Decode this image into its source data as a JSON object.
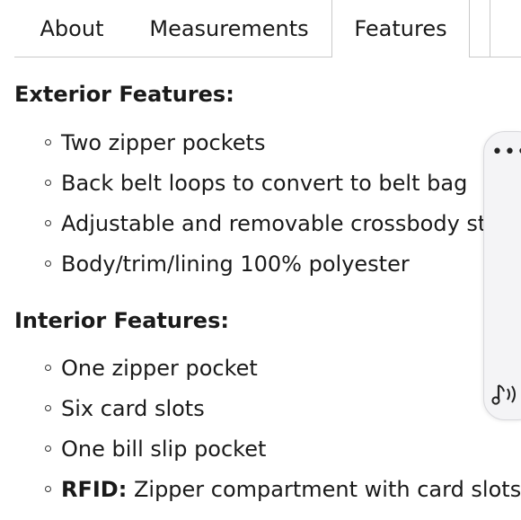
{
  "tabs": [
    {
      "label": "About"
    },
    {
      "label": "Measurements"
    },
    {
      "label": "Features",
      "active": true
    },
    {
      "label": ""
    }
  ],
  "exterior": {
    "title": "Exterior Features:",
    "items": [
      "Two zipper pockets",
      "Back belt loops to convert to belt bag",
      "Adjustable and removable crossbody strap",
      "Body/trim/lining 100% polyester"
    ]
  },
  "interior": {
    "title": "Interior Features:",
    "items": [
      {
        "text": "One zipper pocket"
      },
      {
        "text": "Six card slots"
      },
      {
        "text": "One bill slip pocket"
      },
      {
        "bold": "RFID:",
        "text": " Zipper compartment with card slots"
      }
    ]
  },
  "toolbar": {
    "more_icon": "more-horizontal-icon",
    "speaker_icon": "read-aloud-icon"
  }
}
